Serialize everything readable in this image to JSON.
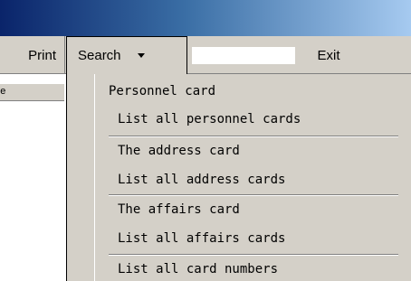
{
  "toolbar": {
    "print_label": "Print",
    "search_label": "Search",
    "search_value": "",
    "exit_label": "Exit"
  },
  "column_header": "e",
  "menu": {
    "items": [
      {
        "label": "Personnel card"
      },
      {
        "label": "List all personnel cards"
      },
      {
        "label": "The address card"
      },
      {
        "label": "List all address cards"
      },
      {
        "label": "The affairs card"
      },
      {
        "label": "List all affairs cards"
      },
      {
        "label": "List all card numbers"
      }
    ]
  }
}
